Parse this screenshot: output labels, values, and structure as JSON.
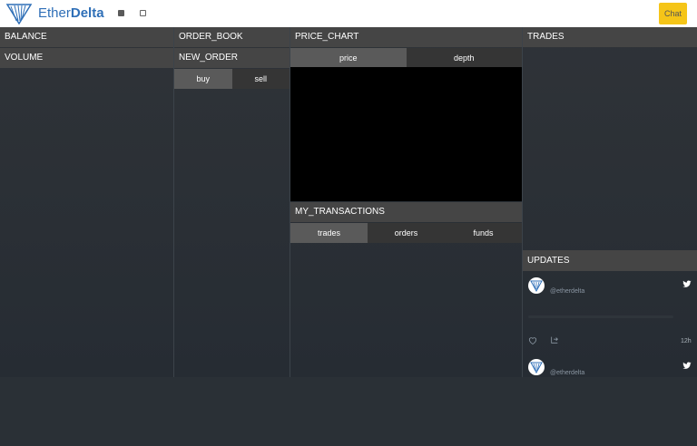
{
  "app": {
    "logo_text_light": "Ether",
    "logo_text_bold": "Delta",
    "chat_label": "Chat",
    "accent_color": "#f5c518",
    "brand_color": "#2f6fb7"
  },
  "panels": {
    "balance": "BALANCE",
    "volume": "VOLUME",
    "order_book": "ORDER_BOOK",
    "new_order": "NEW_ORDER",
    "new_order_tabs": [
      "buy",
      "sell"
    ],
    "price_chart": "PRICE_CHART",
    "price_chart_tabs": [
      "price",
      "depth"
    ],
    "my_transactions": "MY_TRANSACTIONS",
    "my_transactions_tabs": [
      "trades",
      "orders",
      "funds"
    ],
    "trades": "TRADES",
    "updates": "UPDATES"
  },
  "updates_feed": [
    {
      "handle": "@etherdelta",
      "time": "12h",
      "icon": "twitter-icon"
    },
    {
      "handle": "@etherdelta",
      "time": "",
      "icon": "twitter-icon"
    }
  ]
}
